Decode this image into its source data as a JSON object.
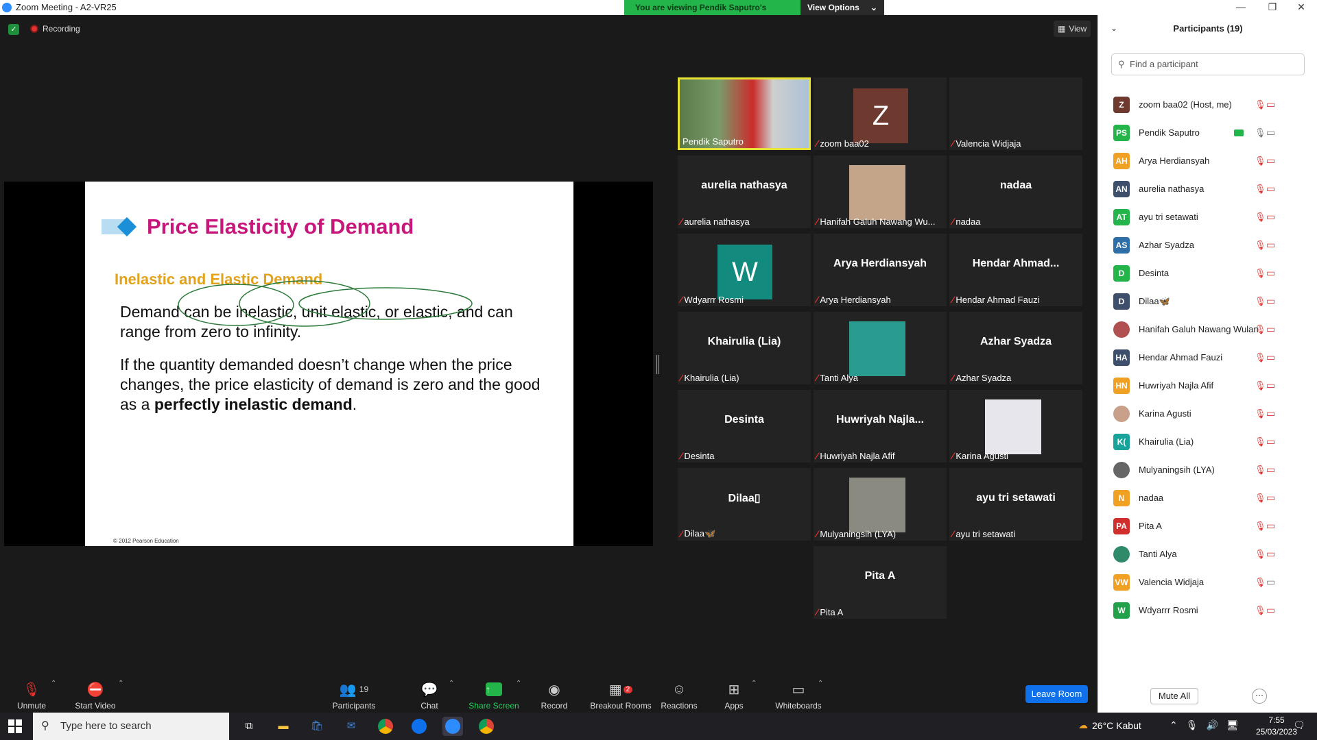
{
  "window": {
    "title": "Zoom Meeting - A2-VR25"
  },
  "banner": {
    "message": "You are viewing Pendik Saputro's screen",
    "options_label": "View Options"
  },
  "top": {
    "recording_label": "Recording",
    "view_label": "View"
  },
  "slide": {
    "title": "Price Elasticity of Demand",
    "subtitle": "Inelastic and Elastic Demand",
    "para1": "Demand can be inelastic, unit elastic, or elastic, and can range from zero to infinity.",
    "para2_start": "If the quantity demanded doesn’t change when the price changes, the price elasticity of demand is zero and the good as a ",
    "para2_bold": "perfectly inelastic demand",
    "para2_end": ".",
    "copyright": "© 2012 Pearson Education"
  },
  "gallery": [
    {
      "name": "Pendik Saputro",
      "display": "photo",
      "active": true
    },
    {
      "name": "zoom baa02",
      "display": "avatar",
      "letter": "Z",
      "color": "#6e3a2f"
    },
    {
      "name": "Valencia Widjaja",
      "display": "photo"
    },
    {
      "name": "aurelia nathasya",
      "display": "text",
      "big": "aurelia nathasya"
    },
    {
      "name": "Hanifah Galuh Nawang Wu...",
      "display": "photo"
    },
    {
      "name": "nadaa",
      "display": "text",
      "big": "nadaa"
    },
    {
      "name": "Wdyarrr Rosmi",
      "display": "avatar",
      "letter": "W",
      "color": "#138a7e"
    },
    {
      "name": "Arya Herdiansyah",
      "display": "text",
      "big": "Arya Herdiansyah"
    },
    {
      "name": "Hendar Ahmad Fauzi",
      "display": "text",
      "big": "Hendar  Ahmad..."
    },
    {
      "name": "Khairulia (Lia)",
      "display": "text",
      "big": "Khairulia (Lia)"
    },
    {
      "name": "Tanti Alya",
      "display": "photo"
    },
    {
      "name": "Azhar Syadza",
      "display": "text",
      "big": "Azhar Syadza"
    },
    {
      "name": "Desinta",
      "display": "text",
      "big": "Desinta"
    },
    {
      "name": "Huwriyah Najla Afif",
      "display": "text",
      "big": "Huwriyah  Najla..."
    },
    {
      "name": "Karina Agusti",
      "display": "photo"
    },
    {
      "name": "Dilaa🦋",
      "display": "text",
      "big": "Dilaa▯"
    },
    {
      "name": "Mulyaningsih (LYA)",
      "display": "photo"
    },
    {
      "name": "ayu tri setawati",
      "display": "text",
      "big": "ayu tri setawati"
    },
    {
      "name": "Pita A",
      "display": "text",
      "big": "Pita A"
    }
  ],
  "toolbar": {
    "unmute": "Unmute",
    "start_video": "Start Video",
    "participants": "Participants",
    "participants_count": "19",
    "chat": "Chat",
    "share_screen": "Share Screen",
    "record": "Record",
    "breakout_rooms": "Breakout Rooms",
    "breakout_badge": "2",
    "reactions": "Reactions",
    "apps": "Apps",
    "whiteboards": "Whiteboards",
    "leave": "Leave Room"
  },
  "panel": {
    "title": "Participants (19)",
    "search_placeholder": "Find a participant",
    "mute_all": "Mute All",
    "participants": [
      {
        "initials": "Z",
        "name": "zoom baa02 (Host, me)",
        "color": "#6e3a2f"
      },
      {
        "initials": "PS",
        "name": "Pendik Saputro",
        "color": "#23b44a",
        "sharing": true
      },
      {
        "initials": "AH",
        "name": "Arya Herdiansyah",
        "color": "#f0a023"
      },
      {
        "initials": "AN",
        "name": "aurelia nathasya",
        "color": "#3d4f6a"
      },
      {
        "initials": "AT",
        "name": "ayu tri setawati",
        "color": "#23b44a"
      },
      {
        "initials": "AS",
        "name": "Azhar Syadza",
        "color": "#2f6fa8"
      },
      {
        "initials": "D",
        "name": "Desinta",
        "color": "#23b44a"
      },
      {
        "initials": "D",
        "name": "Dilaa🦋",
        "color": "#3d4f6a"
      },
      {
        "initials": "",
        "name": "Hanifah Galuh Nawang Wulan",
        "color": "#b05050",
        "photo": true
      },
      {
        "initials": "HA",
        "name": "Hendar Ahmad Fauzi",
        "color": "#3d4f6a"
      },
      {
        "initials": "HN",
        "name": "Huwriyah Najla Afif",
        "color": "#f0a023"
      },
      {
        "initials": "",
        "name": "Karina Agusti",
        "color": "#c9a08a",
        "photo": true
      },
      {
        "initials": "K(",
        "name": "Khairulia (Lia)",
        "color": "#1aa39a"
      },
      {
        "initials": "",
        "name": "Mulyaningsih (LYA)",
        "color": "#666",
        "photo": true
      },
      {
        "initials": "N",
        "name": "nadaa",
        "color": "#f0a023"
      },
      {
        "initials": "PA",
        "name": "Pita A",
        "color": "#d12e2e"
      },
      {
        "initials": "",
        "name": "Tanti Alya",
        "color": "#2f8a6a",
        "photo": true
      },
      {
        "initials": "VW",
        "name": "Valencia Widjaja",
        "color": "#f0a023"
      },
      {
        "initials": "W",
        "name": "Wdyarrr Rosmi",
        "color": "#23a14a"
      }
    ]
  },
  "taskbar": {
    "search_placeholder": "Type here to search",
    "weather": "26°C  Kabut",
    "time": "7:55",
    "date": "25/03/2023"
  }
}
